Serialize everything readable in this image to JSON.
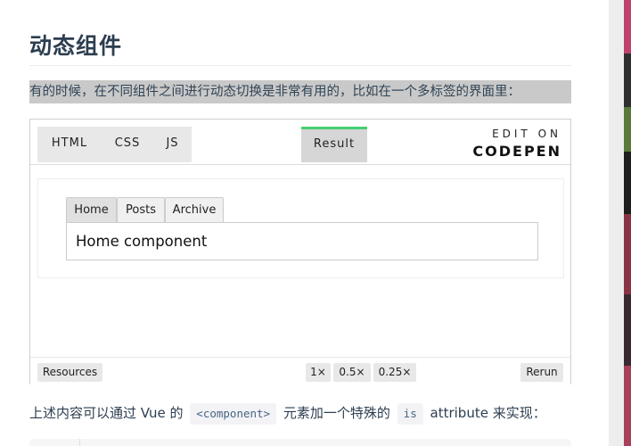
{
  "article": {
    "title": "动态组件",
    "intro": "有的时候，在不同组件之间进行动态切换是非常有用的，比如在一个多标签的界面里：",
    "body_parts": {
      "before_component": "上述内容可以通过 Vue 的",
      "component_code": "<component>",
      "middle": "元素加一个特殊的",
      "is_code": "is",
      "after": "attribute 来实现："
    }
  },
  "codepen": {
    "tabs": [
      "HTML",
      "CSS",
      "JS"
    ],
    "result_tab": "Result",
    "edit_on": "EDIT ON",
    "brand": "CODEPEN",
    "footer": {
      "resources": "Resources",
      "zoom": [
        "1×",
        "0.5×",
        "0.25×"
      ],
      "rerun": "Rerun"
    }
  },
  "demo": {
    "tabs": [
      "Home",
      "Posts",
      "Archive"
    ],
    "active_tab": "Home",
    "content": "Home component"
  },
  "colors": {
    "accent_green": "#47cf73",
    "intro_highlight": "#c9c9c9",
    "inline_code": "#476582"
  }
}
